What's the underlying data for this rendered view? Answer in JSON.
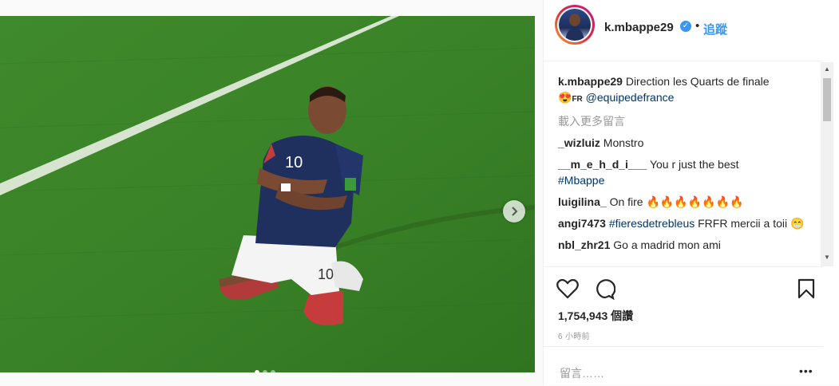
{
  "post": {
    "username": "k.mbappe29",
    "separator": "•",
    "follow_label": "追蹤",
    "likes": "1,754,943 個讚",
    "time_ago": "6 小時前",
    "comment_placeholder": "留言……",
    "more_label": "•••"
  },
  "caption": {
    "username": "k.mbappe29",
    "text": "Direction les Quarts de finale",
    "emoji": "😍",
    "flag": "FR",
    "mention": "@equipedefrance"
  },
  "load_more_label": "載入更多留言",
  "comments": [
    {
      "user": "_wizluiz",
      "text": "Monstro"
    },
    {
      "user": "__m_e_h_d_i___",
      "text": "You r just the best",
      "hashtag": "#Mbappe"
    },
    {
      "user": "luigilina_",
      "text": "On fire 🔥🔥🔥🔥🔥🔥🔥"
    },
    {
      "user": "angi7473",
      "hashtag": "#fieresdetrebleus",
      "text": "FRFR mercii a toii 😁"
    },
    {
      "user": "nbl_zhr21",
      "text": "Go a madrid mon ami"
    }
  ],
  "icons": {
    "like": "heart-icon",
    "comment": "comment-bubble-icon",
    "save": "bookmark-icon",
    "next": "chevron-right-icon",
    "verified": "verified-badge-icon"
  },
  "colors": {
    "link": "#003569",
    "accent": "#3897f0",
    "pitch": "#3f8a2c",
    "jersey": "#1f2f5e"
  },
  "carousel": {
    "count": 3,
    "active": 1
  }
}
